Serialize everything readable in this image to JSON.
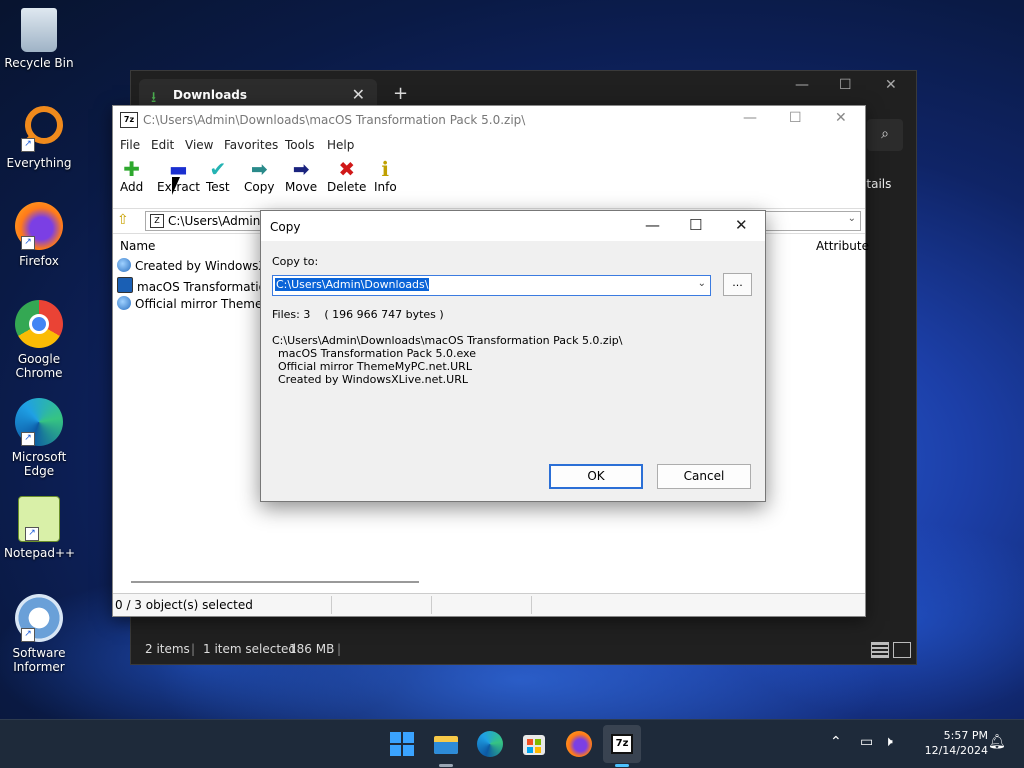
{
  "desktop": {
    "icons": [
      {
        "label": "Recycle Bin",
        "icon": "recycle-bin-icon"
      },
      {
        "label": "Everything",
        "icon": "everything-search-icon"
      },
      {
        "label": "Firefox",
        "icon": "firefox-icon"
      },
      {
        "label": "Google Chrome",
        "icon": "chrome-icon"
      },
      {
        "label": "Microsoft Edge",
        "icon": "edge-icon"
      },
      {
        "label": "Notepad++",
        "icon": "notepadpp-icon"
      },
      {
        "label": "Software Informer",
        "icon": "software-informer-icon"
      }
    ]
  },
  "explorer": {
    "tab_title": "Downloads",
    "details_label": "etails",
    "status": {
      "items": "2 items",
      "selected": "1 item selected",
      "size": "186 MB"
    }
  },
  "sevenzip": {
    "title": "C:\\Users\\Admin\\Downloads\\macOS Transformation Pack 5.0.zip\\",
    "menu": [
      "File",
      "Edit",
      "View",
      "Favorites",
      "Tools",
      "Help"
    ],
    "toolbar": [
      {
        "label": "Add",
        "icon": "plus-icon",
        "color": "#2ea82e"
      },
      {
        "label": "Extract",
        "icon": "minus-icon",
        "color": "#1a2fd0"
      },
      {
        "label": "Test",
        "icon": "check-icon",
        "color": "#24b3b3"
      },
      {
        "label": "Copy",
        "icon": "copy-arrow-icon",
        "color": "#2a8a8a"
      },
      {
        "label": "Move",
        "icon": "move-arrow-icon",
        "color": "#1a237e"
      },
      {
        "label": "Delete",
        "icon": "delete-x-icon",
        "color": "#d01818"
      },
      {
        "label": "Info",
        "icon": "info-icon",
        "color": "#c0a000"
      }
    ],
    "address": "C:\\Users\\Admin\\",
    "columns": {
      "name": "Name",
      "attributes": "Attribute"
    },
    "rows": [
      {
        "name": "Created by WindowsXLi",
        "icon": "url-globe-icon"
      },
      {
        "name": "macOS Transformation",
        "icon": "exe-icon"
      },
      {
        "name": "Official mirror ThemeM",
        "icon": "url-globe-icon"
      }
    ],
    "status": "0 / 3 object(s) selected"
  },
  "dialog": {
    "title": "Copy",
    "copy_to_label": "Copy to:",
    "path_value": "C:\\Users\\Admin\\Downloads\\",
    "browse_label": "...",
    "files_info": "Files: 3    ( 196 966 747 bytes )",
    "archive_path": "C:\\Users\\Admin\\Downloads\\macOS Transformation Pack 5.0.zip\\",
    "items": [
      "macOS Transformation Pack 5.0.exe",
      "Official mirror ThemeMyPC.net.URL",
      "Created by WindowsXLive.net.URL"
    ],
    "ok_label": "OK",
    "cancel_label": "Cancel"
  },
  "taskbar": {
    "apps": [
      "windows-start-icon",
      "file-explorer-icon",
      "edge-icon",
      "store-icon",
      "firefox-icon",
      "7zip-icon"
    ],
    "time": "5:57 PM",
    "date": "12/14/2024"
  }
}
